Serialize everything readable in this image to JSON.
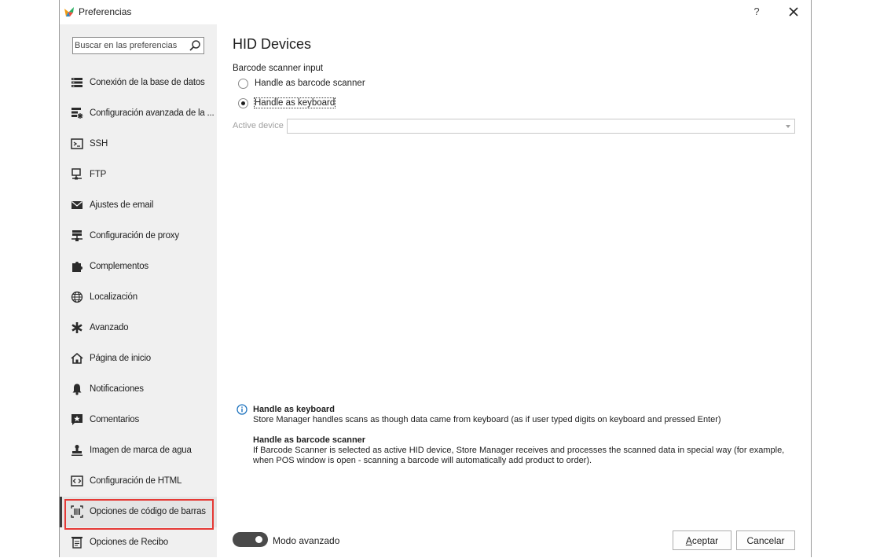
{
  "window": {
    "title": "Preferencias"
  },
  "titlebar": {
    "help_label": "?"
  },
  "search": {
    "placeholder": "Buscar en las preferencias"
  },
  "sidebar": {
    "items": [
      {
        "label": "Conexión de la base de datos",
        "icon": "database-icon"
      },
      {
        "label": "Configuración avanzada de la ...",
        "icon": "server-settings-icon"
      },
      {
        "label": "SSH",
        "icon": "terminal-icon"
      },
      {
        "label": "FTP",
        "icon": "ftp-icon"
      },
      {
        "label": "Ajustes de email",
        "icon": "email-icon"
      },
      {
        "label": "Configuración de proxy",
        "icon": "proxy-icon"
      },
      {
        "label": "Complementos",
        "icon": "puzzle-icon"
      },
      {
        "label": "Localización",
        "icon": "globe-icon"
      },
      {
        "label": "Avanzado",
        "icon": "asterisk-icon"
      },
      {
        "label": "Página de inicio",
        "icon": "home-icon"
      },
      {
        "label": "Notificaciones",
        "icon": "bell-icon"
      },
      {
        "label": "Comentarios",
        "icon": "comment-star-icon"
      },
      {
        "label": "Imagen de marca de agua",
        "icon": "stamp-icon"
      },
      {
        "label": "Configuración de HTML",
        "icon": "code-icon"
      },
      {
        "label": "Opciones de código de barras",
        "icon": "barcode-icon",
        "selected": true
      },
      {
        "label": "Opciones de Recibo",
        "icon": "receipt-icon"
      }
    ]
  },
  "main": {
    "title": "HID Devices",
    "group_label": "Barcode scanner input",
    "radio_options": [
      {
        "label": "Handle as barcode scanner",
        "checked": false
      },
      {
        "label": "Handle as keyboard",
        "checked": true
      }
    ],
    "active_device_label": "Active device",
    "active_device_value": "",
    "info": {
      "keyboard_title": "Handle as keyboard",
      "keyboard_text": "Store Manager handles scans as though data came from keyboard (as if user typed digits on keyboard and pressed Enter)",
      "scanner_title": "Handle as barcode scanner",
      "scanner_text": "If Barcode Scanner is selected as active HID device, Store Manager receives and processes the scanned data in special way (for example, when POS window is open - scanning a barcode will automatically add product to order)."
    }
  },
  "footer": {
    "advanced_mode_label": "Modo avanzado",
    "advanced_mode_on": true,
    "accept_first": "A",
    "accept_rest": "ceptar",
    "cancel_label": "Cancelar"
  },
  "colors": {
    "highlight": "#e53935",
    "accent": "#1e73be",
    "sidebar_bg": "#f0f0f0"
  }
}
